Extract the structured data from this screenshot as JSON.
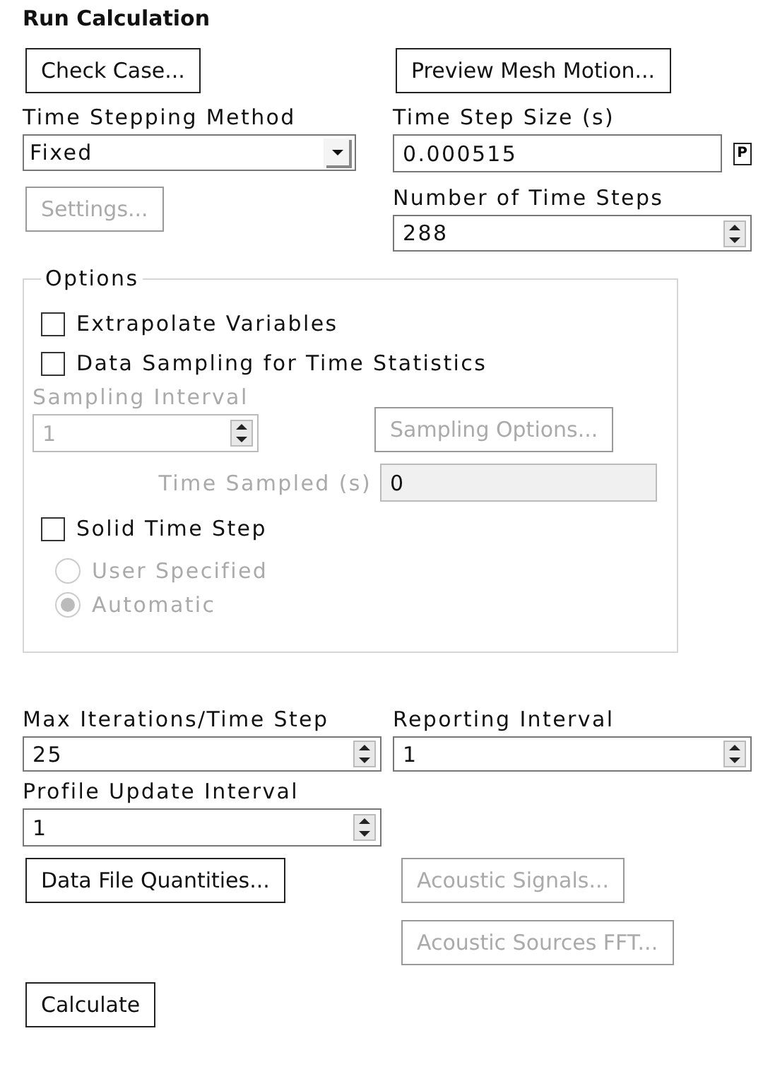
{
  "title": "Run Calculation",
  "top_buttons": [
    {
      "label": "Check Case...",
      "disabled": false
    },
    {
      "label": "Preview Mesh Motion...",
      "disabled": false
    }
  ],
  "time_stepping_method": {
    "label": "Time Stepping Method",
    "value": "Fixed"
  },
  "settings_button": {
    "label": "Settings...",
    "disabled": true
  },
  "time_step_size": {
    "label": "Time Step Size (s)",
    "value": "0.000515",
    "parameter_button": "P"
  },
  "number_of_time_steps": {
    "label": "Number of Time Steps",
    "value": "288"
  },
  "options": {
    "title": "Options",
    "extrapolate_variables": {
      "label": "Extrapolate Variables",
      "checked": false
    },
    "data_sampling": {
      "label": "Data Sampling for Time Statistics",
      "checked": false
    },
    "sampling_interval": {
      "label": "Sampling Interval",
      "value": "1",
      "disabled": true
    },
    "sampling_options_button": {
      "label": "Sampling Options...",
      "disabled": true
    },
    "time_sampled": {
      "label": "Time Sampled (s)",
      "value": "0",
      "disabled": true
    },
    "solid_time_step": {
      "label": "Solid Time Step",
      "checked": false
    },
    "radios": [
      {
        "label": "User Specified",
        "selected": false,
        "disabled": true
      },
      {
        "label": "Automatic",
        "selected": true,
        "disabled": true
      }
    ]
  },
  "max_iterations": {
    "label": "Max Iterations/Time Step",
    "value": "25"
  },
  "reporting_interval": {
    "label": "Reporting Interval",
    "value": "1"
  },
  "profile_update_interval": {
    "label": "Profile Update Interval",
    "value": "1"
  },
  "bottom_buttons": [
    {
      "label": "Data File Quantities...",
      "disabled": false
    },
    {
      "label": "Acoustic Signals...",
      "disabled": true
    },
    {
      "label": "Acoustic Sources FFT...",
      "disabled": true
    }
  ],
  "calculate_button": {
    "label": "Calculate",
    "disabled": false
  }
}
